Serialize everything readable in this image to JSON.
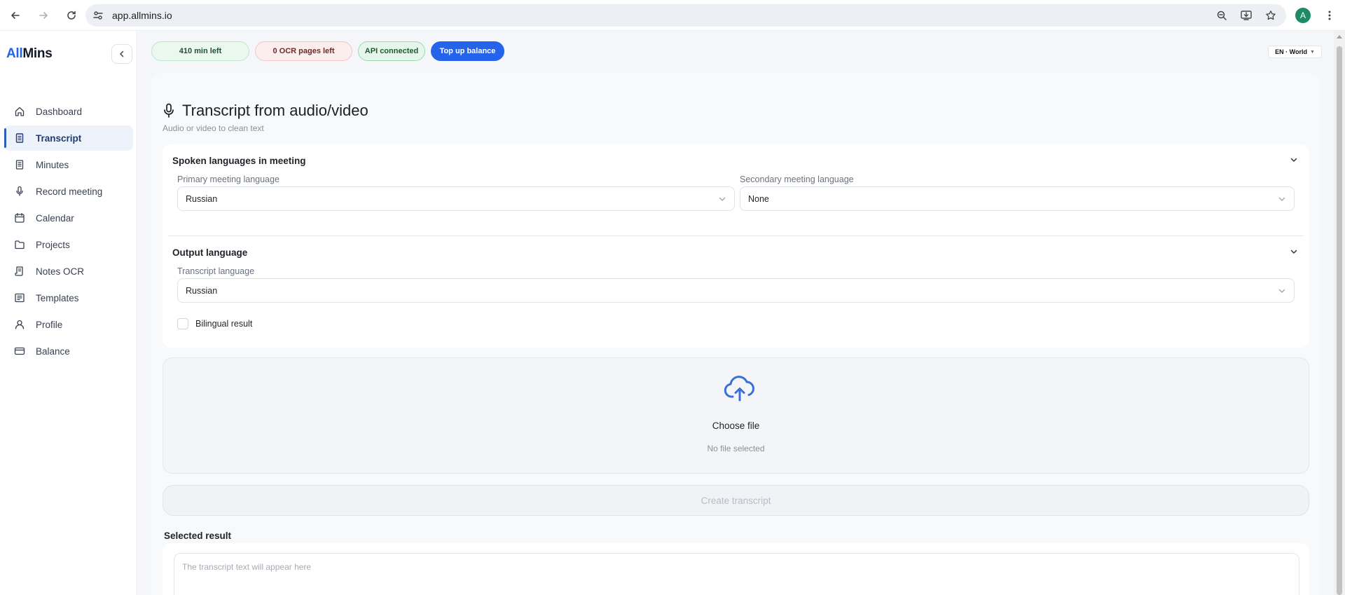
{
  "browser": {
    "url": "app.allmins.io",
    "profile_initial": "A"
  },
  "sidebar": {
    "logo_accent": "All",
    "logo_rest": "Mins",
    "items": [
      {
        "label": "Dashboard",
        "icon": "home-icon"
      },
      {
        "label": "Transcript",
        "icon": "document-icon",
        "active": true
      },
      {
        "label": "Minutes",
        "icon": "list-document-icon"
      },
      {
        "label": "Record meeting",
        "icon": "microphone-icon"
      },
      {
        "label": "Calendar",
        "icon": "calendar-icon"
      },
      {
        "label": "Projects",
        "icon": "folder-icon"
      },
      {
        "label": "Notes OCR",
        "icon": "scroll-icon"
      },
      {
        "label": "Templates",
        "icon": "template-icon"
      },
      {
        "label": "Profile",
        "icon": "user-icon"
      },
      {
        "label": "Balance",
        "icon": "card-icon"
      }
    ]
  },
  "topbar": {
    "minutes_left": "410 min left",
    "ocr_left": "0 OCR pages left",
    "api_status": "API connected",
    "topup_label": "Top up balance",
    "locale": "EN · World"
  },
  "page": {
    "title": "Transcript from audio/video",
    "subtitle": "Audio or video to clean text"
  },
  "spoken": {
    "title": "Spoken languages in meeting",
    "primary_label": "Primary meeting language",
    "primary_value": "Russian",
    "secondary_label": "Secondary meeting language",
    "secondary_value": "None"
  },
  "output": {
    "title": "Output language",
    "transcript_label": "Transcript language",
    "transcript_value": "Russian",
    "bilingual_label": "Bilingual result"
  },
  "upload": {
    "choose_label": "Choose file",
    "status": "No file selected"
  },
  "actions": {
    "create_label": "Create transcript"
  },
  "result": {
    "title": "Selected result",
    "placeholder": "The transcript text will appear here"
  },
  "colors": {
    "accent": "#2563eb",
    "active_nav": "#1f3b73",
    "api_green": "#1c5a2d"
  }
}
